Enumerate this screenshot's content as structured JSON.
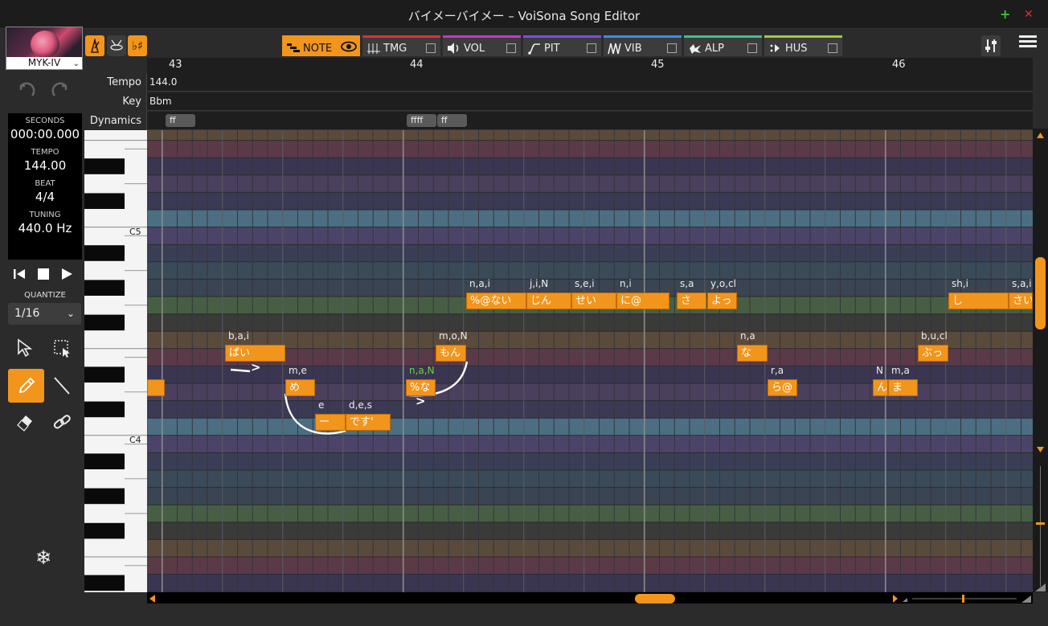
{
  "window": {
    "title": "バイメーバイメー – VoiSona Song Editor",
    "plus": "+",
    "close": "✕"
  },
  "sidebar": {
    "avatar_name": "MYK-IV",
    "seconds_label": "SECONDS",
    "seconds_value": "000:00.000",
    "tempo_label": "TEMPO",
    "tempo_value": "144.00",
    "beat_label": "BEAT",
    "beat_value": "4/4",
    "tuning_label": "TUNING",
    "tuning_value": "440.0 Hz",
    "quantize_label": "QUANTIZE",
    "quantize_value": "1/16"
  },
  "tabs": [
    {
      "label": "NOTE",
      "color": "#f2951c"
    },
    {
      "label": "TMG",
      "color": "#d9303a"
    },
    {
      "label": "VOL",
      "color": "#c03ac8"
    },
    {
      "label": "PIT",
      "color": "#7a4ee0"
    },
    {
      "label": "VIB",
      "color": "#3f8de0"
    },
    {
      "label": "ALP",
      "color": "#3ec08a"
    },
    {
      "label": "HUS",
      "color": "#9ecb3c"
    }
  ],
  "ruler": {
    "measures": [
      "43",
      "44",
      "45",
      "46"
    ]
  },
  "tracks": {
    "tempo_label": "Tempo",
    "tempo_value": "144.0",
    "key_label": "Key",
    "key_value": "Bbm",
    "dynamics_label": "Dynamics",
    "dynamics": [
      "ff",
      "ffff",
      "ff"
    ]
  },
  "piano": {
    "c5": "C5",
    "c4": "C4"
  },
  "notes": [
    {
      "ph": "",
      "lyric": ""
    },
    {
      "ph": "b,a,i",
      "lyric": "ばい"
    },
    {
      "ph": "m,e",
      "lyric": "め"
    },
    {
      "ph": "e",
      "lyric": "ー"
    },
    {
      "ph": "d,e,s",
      "lyric": "です'"
    },
    {
      "ph": "n,a,N",
      "lyric": "%な"
    },
    {
      "ph": "m,o,N",
      "lyric": "もん"
    },
    {
      "ph": "n,a,i",
      "lyric": "%@ない"
    },
    {
      "ph": "j,i,N",
      "lyric": "じん"
    },
    {
      "ph": "s,e,i",
      "lyric": "せい"
    },
    {
      "ph": "n,i",
      "lyric": "に@"
    },
    {
      "ph": "s,a",
      "lyric": "さ"
    },
    {
      "ph": "y,o,cl",
      "lyric": "よっ"
    },
    {
      "ph": "n,a",
      "lyric": "な"
    },
    {
      "ph": "r,a",
      "lyric": "ら@"
    },
    {
      "ph": "N",
      "lyric": "ん"
    },
    {
      "ph": "m,a",
      "lyric": "ま"
    },
    {
      "ph": "b,u,cl",
      "lyric": "ぶっ"
    },
    {
      "ph": "sh,i",
      "lyric": "し"
    },
    {
      "ph": "s,a,i",
      "lyric": "さい"
    }
  ],
  "accent_color": "#f2951c"
}
